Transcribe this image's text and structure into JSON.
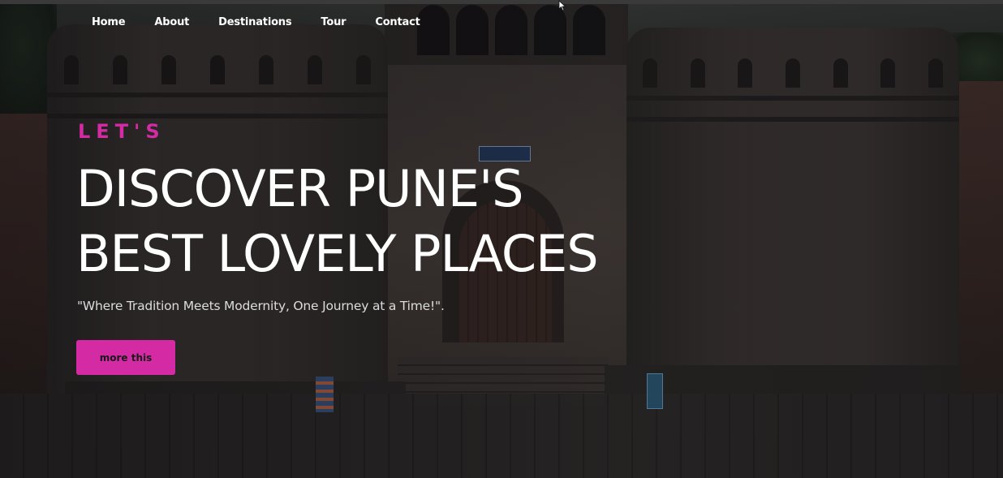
{
  "nav": {
    "items": [
      {
        "label": "Home"
      },
      {
        "label": "About"
      },
      {
        "label": "Destinations"
      },
      {
        "label": "Tour"
      },
      {
        "label": "Contact"
      }
    ]
  },
  "hero": {
    "eyebrow": "LET'S",
    "headline_line1": "DISCOVER PUNE'S",
    "headline_line2": "BEST LOVELY PLACES",
    "tagline": "\"Where Tradition Meets Modernity, One Journey at a Time!\".",
    "cta_label": "more this"
  },
  "colors": {
    "accent": "#d42ba4",
    "text": "#ffffff"
  },
  "icons": {
    "cursor": "mouse-pointer-icon"
  }
}
